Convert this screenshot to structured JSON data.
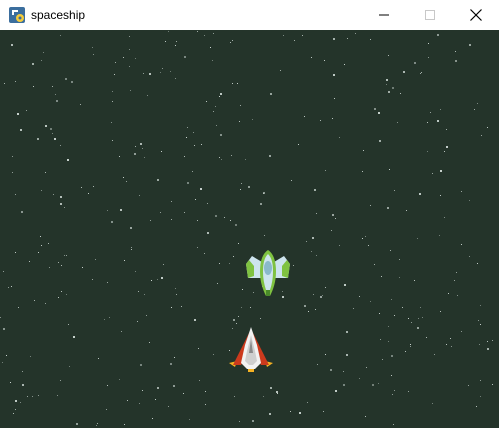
{
  "window": {
    "title": "spaceship",
    "controls": {
      "minimize": "minimize",
      "maximize": "maximize",
      "close": "close"
    }
  },
  "game": {
    "background_color": "#24342a",
    "star_color": "#c9d4cf",
    "enemy_ship": {
      "icon": "green-alien-ship",
      "colors": {
        "body": "#7fc241",
        "wings": "#cde4ee",
        "cockpit": "#8ab9ca"
      }
    },
    "player_ship": {
      "icon": "red-white-rocket-ship",
      "colors": {
        "body": "#f2f2f2",
        "wings": "#cc3a1d",
        "flame": "#f6b223"
      }
    }
  }
}
